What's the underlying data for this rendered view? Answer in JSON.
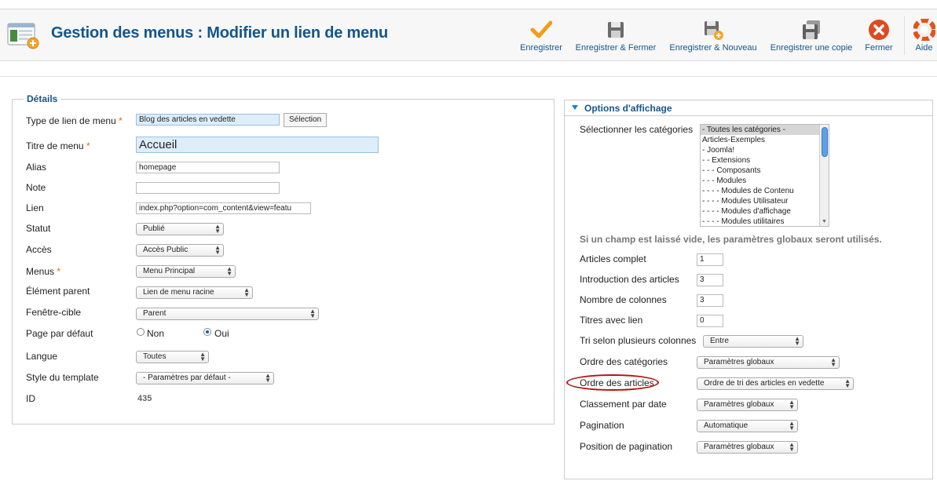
{
  "header": {
    "title": "Gestion des menus : Modifier un lien de menu",
    "icon": "menu-manager-icon"
  },
  "toolbar": {
    "buttons": [
      {
        "label": "Enregistrer",
        "icon": "check-icon"
      },
      {
        "label": "Enregistrer & Fermer",
        "icon": "save-close-icon"
      },
      {
        "label": "Enregistrer & Nouveau",
        "icon": "save-new-icon"
      },
      {
        "label": "Enregistrer une copie",
        "icon": "save-copy-icon"
      },
      {
        "label": "Fermer",
        "icon": "close-icon"
      },
      {
        "label": "Aide",
        "icon": "help-icon"
      }
    ]
  },
  "details": {
    "legend": "Détails",
    "menu_type": {
      "label": "Type de lien de menu",
      "required": "*",
      "value": "Blog des articles en vedette",
      "button": "Sélection"
    },
    "title": {
      "label": "Titre de menu",
      "required": "*",
      "value": "Accueil"
    },
    "alias": {
      "label": "Alias",
      "value": "homepage"
    },
    "note": {
      "label": "Note",
      "value": ""
    },
    "link": {
      "label": "Lien",
      "value": "index.php?option=com_content&view=featu"
    },
    "status": {
      "label": "Statut",
      "value": "Publié"
    },
    "access": {
      "label": "Accès",
      "value": "Accès Public"
    },
    "menu": {
      "label": "Menus",
      "required": "*",
      "value": "Menu Principal"
    },
    "parent": {
      "label": "Élément parent",
      "value": "Lien de menu racine"
    },
    "target": {
      "label": "Fenêtre-cible",
      "value": "Parent"
    },
    "default_page": {
      "label": "Page par défaut",
      "option_no": "Non",
      "option_yes": "Oui",
      "selected": "Oui"
    },
    "language": {
      "label": "Langue",
      "value": "Toutes"
    },
    "template_style": {
      "label": "Style du template",
      "value": "- Paramètres par défaut -"
    },
    "id": {
      "label": "ID",
      "value": "435"
    }
  },
  "options": {
    "title": "Options d'affichage",
    "categories_label": "Sélectionner les catégories",
    "categories": [
      "- Toutes les catégories -",
      "Articles-Exemples",
      "- Joomla!",
      "- - Extensions",
      "- - - Composants",
      "- - - Modules",
      "- - - - Modules de Contenu",
      "- - - - Modules Utilisateur",
      "- - - - Modules d'affichage",
      "- - - - Modules utilitaires"
    ],
    "note": "Si un champ est laissé vide, les paramètres globaux seront utilisés.",
    "fields": {
      "articles_complet": {
        "label": "Articles complet",
        "value": "1"
      },
      "intro_articles": {
        "label": "Introduction des articles",
        "value": "3"
      },
      "columns": {
        "label": "Nombre de colonnes",
        "value": "3"
      },
      "links": {
        "label": "Titres avec lien",
        "value": "0"
      },
      "multi_column_order": {
        "label": "Tri selon plusieurs colonnes",
        "value": "Entre"
      },
      "category_order": {
        "label": "Ordre des catégories",
        "value": "Paramètres globaux"
      },
      "article_order": {
        "label": "Ordre des articles",
        "value": "Ordre de tri des articles en vedette"
      },
      "date_order": {
        "label": "Classement par date",
        "value": "Paramètres globaux"
      },
      "pagination": {
        "label": "Pagination",
        "value": "Automatique"
      },
      "pagination_position": {
        "label": "Position de pagination",
        "value": "Paramètres globaux"
      }
    }
  },
  "colors": {
    "title_blue": "#14568a",
    "required_orange": "#e06b00",
    "annotation_red": "#b31212",
    "check_orange": "#f39c1b",
    "close_red": "#e04a1e"
  }
}
